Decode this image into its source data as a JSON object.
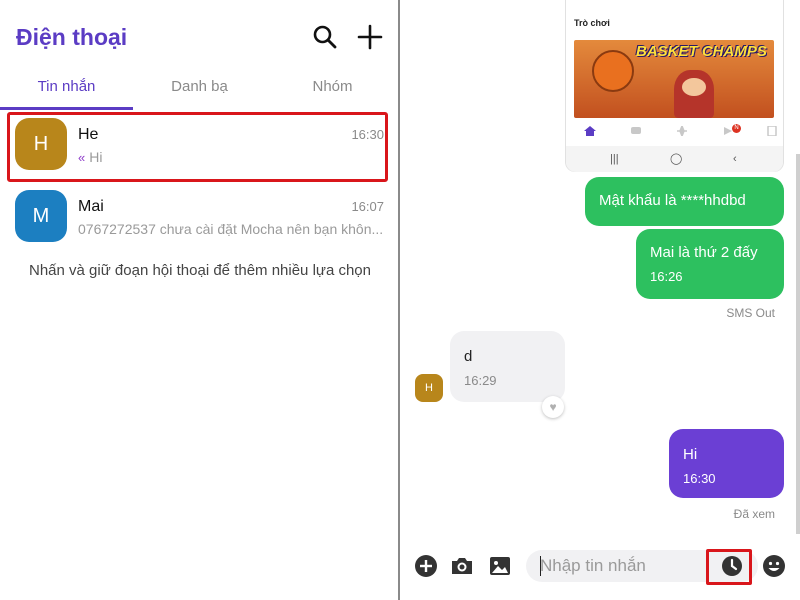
{
  "left": {
    "title": "Điện thoại",
    "icons": [
      "search-icon",
      "plus-icon"
    ],
    "tabs": [
      {
        "label": "Tin nhắn",
        "active": true
      },
      {
        "label": "Danh bạ",
        "active": false
      },
      {
        "label": "Nhóm",
        "active": false
      }
    ],
    "conversations": [
      {
        "avatar_letter": "H",
        "name": "He",
        "time": "16:30",
        "preview_prefix": "«",
        "preview": "Hi",
        "avatar_color": "#b8861b"
      },
      {
        "avatar_letter": "M",
        "name": "Mai",
        "time": "16:07",
        "preview": "0767272537 chưa cài đặt Mocha nên bạn khôn...",
        "avatar_color": "#1c7fc1"
      }
    ],
    "hint": "Nhấn và giữ đoạn hội thoại để thêm nhiều lựa chọn"
  },
  "right": {
    "game_card": {
      "title": "Trò chơi",
      "logo": "BASKET CHAMPS",
      "badge": "N"
    },
    "messages": [
      {
        "direction": "out",
        "text": "Mật khẩu là ****hhdbd"
      },
      {
        "direction": "out",
        "text": "Mai là thứ 2 đấy",
        "time": "16:26",
        "status": "SMS Out"
      },
      {
        "direction": "in",
        "sender_letter": "H",
        "text": "d",
        "time": "16:29"
      },
      {
        "direction": "out",
        "text": "Hi",
        "time": "16:30",
        "status": "Đã xem"
      }
    ],
    "input": {
      "placeholder": "Nhập tin nhắn",
      "icons": [
        "add-icon",
        "camera-icon",
        "image-icon",
        "clock-icon",
        "emoji-icon"
      ]
    }
  },
  "colors": {
    "accent": "#5b3cc4",
    "outgoing_bubble": "#2dc05f",
    "incoming_bubble": "#f1f1f3",
    "seen_bubble": "#6b3fd4",
    "highlight": "#d9161b"
  }
}
